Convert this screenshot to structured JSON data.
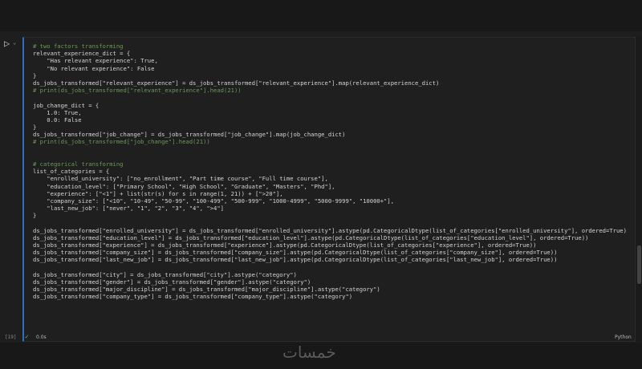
{
  "cell": {
    "lines": [
      "# two factors transforming",
      "relevant_experience_dict = {",
      "    \"Has relevant experience\": True,",
      "    \"No relevant experience\": False",
      "}",
      "ds_jobs_transformed[\"relevant_experience\"] = ds_jobs_transformed[\"relevant_experience\"].map(relevant_experience_dict)",
      "# print(ds_jobs_transformed[\"relevant_experience\"].head(21))",
      "",
      "job_change_dict = {",
      "    1.0: True,",
      "    0.0: False",
      "}",
      "ds_jobs_transformed[\"job_change\"] = ds_jobs_transformed[\"job_change\"].map(job_change_dict)",
      "# print(ds_jobs_transformed[\"job_change\"].head(21))",
      "",
      "",
      "# categorical transforming",
      "list_of_categories = {",
      "    \"enrolled_university\": [\"no_enrollment\", \"Part time course\", \"Full time course\"],",
      "    \"education_level\": [\"Primary School\", \"High School\", \"Graduate\", \"Masters\", \"Phd\"],",
      "    \"experience\": [\"<1\"] + list(str(s) for s in range(1, 21)) + [\">20\"],",
      "    \"company_size\": [\"<10\", \"10-49\", \"50-99\", \"100-499\", \"500-999\", \"1000-4999\", \"5000-9999\", \"10000+\"],",
      "    \"last_new_job\": [\"never\", \"1\", \"2\", \"3\", \"4\", \">4\"]",
      "}",
      "",
      "ds_jobs_transformed[\"enrolled_university\"] = ds_jobs_transformed[\"enrolled_university\"].astype(pd.CategoricalDtype(list_of_categories[\"enrolled_university\"], ordered=True))",
      "ds_jobs_transformed[\"education_level\"] = ds_jobs_transformed[\"education_level\"].astype(pd.CategoricalDtype(list_of_categories[\"education_level\"], ordered=True))",
      "ds_jobs_transformed[\"experience\"] = ds_jobs_transformed[\"experience\"].astype(pd.CategoricalDtype(list_of_categories[\"experience\"], ordered=True))",
      "ds_jobs_transformed[\"company_size\"] = ds_jobs_transformed[\"company_size\"].astype(pd.CategoricalDtype(list_of_categories[\"company_size\"], ordered=True))",
      "ds_jobs_transformed[\"last_new_job\"] = ds_jobs_transformed[\"last_new_job\"].astype(pd.CategoricalDtype(list_of_categories[\"last_new_job\"], ordered=True))",
      "",
      "ds_jobs_transformed[\"city\"] = ds_jobs_transformed[\"city\"].astype(\"category\")",
      "ds_jobs_transformed[\"gender\"] = ds_jobs_transformed[\"gender\"].astype(\"category\")",
      "ds_jobs_transformed[\"major_discipline\"] = ds_jobs_transformed[\"major_discipline\"].astype(\"category\")",
      "ds_jobs_transformed[\"company_type\"] = ds_jobs_transformed[\"company_type\"].astype(\"category\")"
    ],
    "exec_count": "[19]",
    "exec_time": "0.0s",
    "language": "Python",
    "run_icon": "play-icon",
    "status_icon": "check-icon"
  },
  "watermark": "خمسات"
}
